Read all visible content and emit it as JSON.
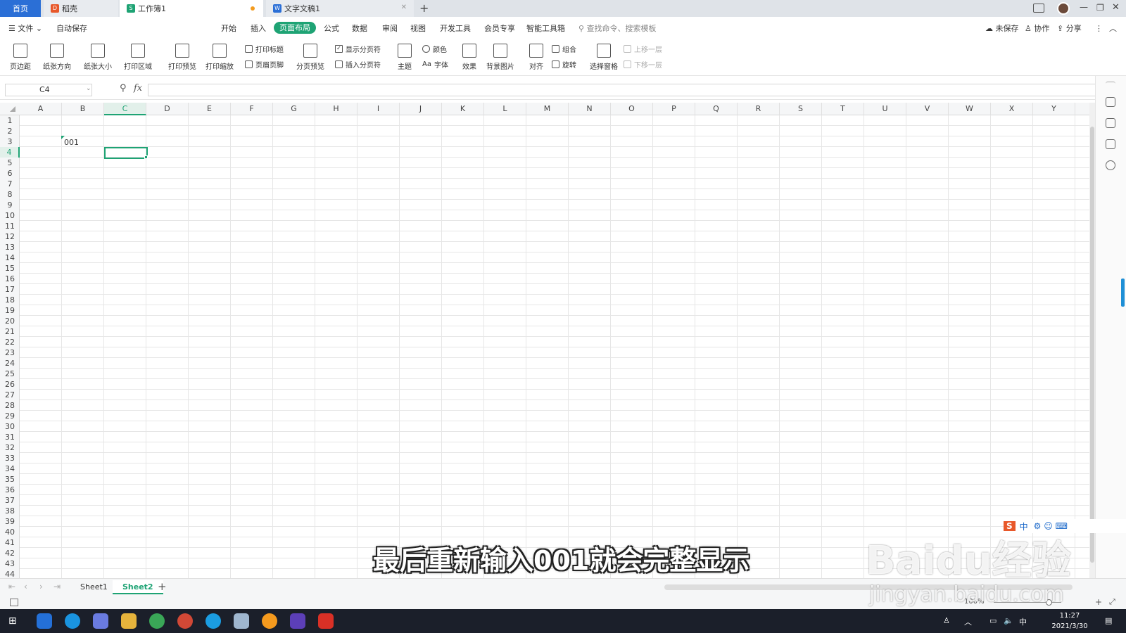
{
  "tabs": [
    {
      "label": "首页",
      "active": false
    },
    {
      "label": "稻壳",
      "active": false
    },
    {
      "label": "工作簿1",
      "active": true
    },
    {
      "label": "文字文稿1",
      "active": false
    }
  ],
  "menu": {
    "file": "文件",
    "autosave": "自动保存",
    "items": [
      "开始",
      "插入",
      "页面布局",
      "公式",
      "数据",
      "审阅",
      "视图",
      "开发工具",
      "会员专享",
      "智能工具箱"
    ],
    "active_item": "页面布局",
    "search_placeholder": "查找命令、搜索模板",
    "unsaved": "未保存",
    "collab": "协作",
    "share": "分享"
  },
  "ribbon": {
    "margin": "页边距",
    "orientation": "纸张方向",
    "size": "纸张大小",
    "print_area": "打印区域",
    "print_preview": "打印预览",
    "print_scale": "打印缩放",
    "print_titles": "打印标题",
    "header_footer": "页眉页脚",
    "page_break_preview": "分页预览",
    "show_page_breaks": "显示分页符",
    "insert_page_break": "插入分页符",
    "theme": "主题",
    "colors": "颜色",
    "fonts": "字体",
    "effects": "效果",
    "bg_image": "背景图片",
    "align": "对齐",
    "group": "组合",
    "rotate": "旋转",
    "selection_pane": "选择窗格",
    "bring_forward": "上移一层",
    "send_backward": "下移一层"
  },
  "formula_bar": {
    "name_box": "C4",
    "fx": "fx",
    "value": ""
  },
  "columns": [
    "A",
    "B",
    "C",
    "D",
    "E",
    "F",
    "G",
    "H",
    "I",
    "J",
    "K",
    "L",
    "M",
    "N",
    "O",
    "P",
    "Q",
    "R",
    "S",
    "T",
    "U",
    "V",
    "W",
    "X",
    "Y"
  ],
  "selected_column": "C",
  "rows": [
    "1",
    "2",
    "3",
    "4",
    "5",
    "6",
    "7",
    "8",
    "9",
    "10",
    "11",
    "12",
    "13",
    "14",
    "15",
    "16",
    "17",
    "18",
    "19",
    "20",
    "21",
    "22",
    "23",
    "24",
    "25",
    "26",
    "27",
    "28",
    "29",
    "30",
    "31",
    "32",
    "33",
    "34",
    "35",
    "36",
    "37",
    "38",
    "39",
    "40",
    "41",
    "42",
    "43",
    "44"
  ],
  "selected_row": "4",
  "cell_B3": "001",
  "sheets": [
    {
      "label": "Sheet1",
      "active": false
    },
    {
      "label": "Sheet2",
      "active": true
    }
  ],
  "statusbar": {
    "zoom": "100%"
  },
  "taskbar": {
    "time": "11:27",
    "date": "2021/3/30",
    "ime_lang": "中"
  },
  "subtitle": "最后重新输入001就会完整显示",
  "watermark": {
    "brand": "Baidu经验",
    "url": "jingyan.baidu.com"
  },
  "colors": {
    "accent": "#1ea374",
    "tab_home": "#2b6fd6"
  }
}
